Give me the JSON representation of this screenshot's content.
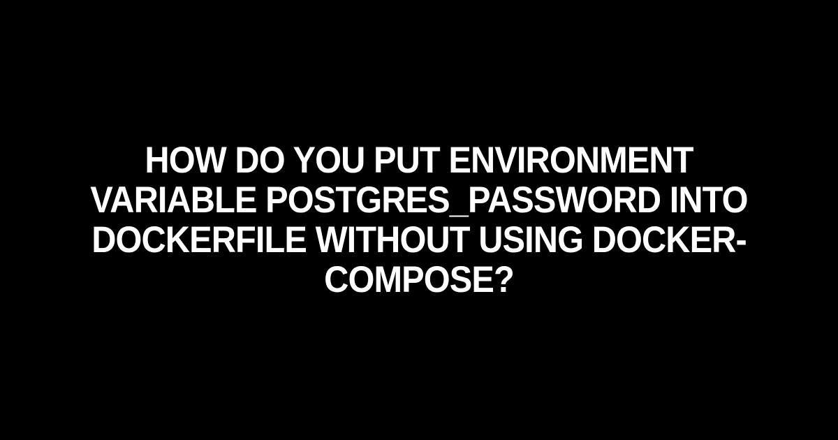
{
  "heading": {
    "text": "HOW DO YOU PUT ENVIRONMENT VARIABLE POSTGRES_PASSWORD INTO DOCKERFILE WITHOUT USING DOCKER-COMPOSE?"
  }
}
